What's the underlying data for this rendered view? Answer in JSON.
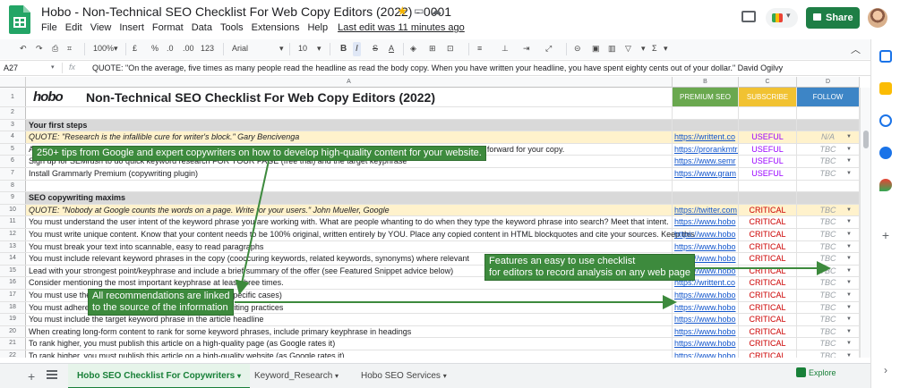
{
  "header": {
    "doc_title": "Hobo - Non-Technical SEO Checklist For Web Copy Editors (2022) - 0001",
    "menus": [
      "File",
      "Edit",
      "View",
      "Insert",
      "Format",
      "Data",
      "Tools",
      "Extensions",
      "Help"
    ],
    "last_edit": "Last edit was 11 minutes ago",
    "share_label": "Share"
  },
  "toolbar": {
    "zoom": "100%",
    "currency": "£",
    "percent": "%",
    "dec_less": ".0",
    "dec_more": ".00",
    "fmt": "123",
    "font": "Arial",
    "size": "10"
  },
  "formula_bar": {
    "cell_ref": "A27",
    "fx": "fx",
    "value": "QUOTE: \"On the average, five times as many people read the headline as read the body copy. When you have written your headline, you have spent eighty cents out of your dollar.\" David Ogilvy"
  },
  "columns": [
    "A",
    "B",
    "C",
    "D"
  ],
  "header_row": {
    "num": "1",
    "title": "Non-Technical SEO Checklist For Web Copy Editors (2022)",
    "logo_text": "hobo",
    "b": "PREMIUM SEO",
    "c": "SUBSCRIBE",
    "d": "FOLLOW"
  },
  "rows": [
    {
      "num": "2",
      "type": "blank",
      "a": "",
      "b": "",
      "c": "",
      "d": ""
    },
    {
      "num": "3",
      "type": "section",
      "a": "Your first steps",
      "b": "",
      "c": "",
      "d": ""
    },
    {
      "num": "4",
      "type": "quote",
      "a": "QUOTE: \"Research is the infallible cure for writer's block.\" Gary Bencivenga",
      "b": "https://writtent.co",
      "c": "USEFUL",
      "d": "N/A"
    },
    {
      "num": "5",
      "type": "item",
      "a": "Add keywords FOR YOUR PAGE to a spreadsheet (free) to track your rankings on a daily level and monitor your progress going forward for your copy.",
      "b": "https://prorankmtra",
      "c": "USEFUL",
      "d": "TBC"
    },
    {
      "num": "6",
      "type": "item",
      "a": "Sign up for SEMrush to do quick keyword research FOR YOUR PAGE (free trial) and the target keyphrase",
      "b": "https://www.semr",
      "c": "USEFUL",
      "d": "TBC"
    },
    {
      "num": "7",
      "type": "item",
      "a": "Install Grammarly Premium (copywriting plugin)",
      "b": "https://www.gram",
      "c": "USEFUL",
      "d": "TBC"
    },
    {
      "num": "8",
      "type": "blank",
      "a": "",
      "b": "",
      "c": "",
      "d": ""
    },
    {
      "num": "9",
      "type": "section",
      "a": "SEO copywriting maxims",
      "b": "",
      "c": "",
      "d": ""
    },
    {
      "num": "10",
      "type": "quote",
      "a": "QUOTE: \"Nobody at Google counts the words on a page. Write for your users.\" John Mueller, Google",
      "b": "https://twitter.com",
      "c": "CRITICAL",
      "d": "TBC"
    },
    {
      "num": "11",
      "type": "item",
      "a": "You must understand the user intent of the keyword phrase you are working with. What are people whanting to do when they type the keyword phrase into search? Meet that intent.",
      "b": "https://www.hobo",
      "c": "CRITICAL",
      "d": "TBC"
    },
    {
      "num": "12",
      "type": "item",
      "a": "You must write unique content. Know that your content needs to be 100% original, written entirely by YOU. Place any copied content in HTML blockquotes and cite your sources. Keep this",
      "b": "https://www.hobo",
      "c": "CRITICAL",
      "d": "TBC"
    },
    {
      "num": "13",
      "type": "item",
      "a": "You must break your text into scannable, easy to read paragraphs",
      "b": "https://www.hobo",
      "c": "CRITICAL",
      "d": "TBC"
    },
    {
      "num": "14",
      "type": "item",
      "a": "You must include relevant keyword phrases in the copy (cooccuring keywords, related keywords, synonyms) where relevant",
      "b": "https://www.hobo",
      "c": "CRITICAL",
      "d": "TBC"
    },
    {
      "num": "15",
      "type": "item",
      "a": "Lead with your strongest point/keyphrase and include a brief summary of the offer (see Featured Snippet advice below)",
      "b": "https://www.hobo",
      "c": "CRITICAL",
      "d": "TBC"
    },
    {
      "num": "16",
      "type": "item",
      "a": "Consider mentioning the most important keyphrase at least three times.",
      "b": "https://writtent.co",
      "c": "CRITICAL",
      "d": "TBC"
    },
    {
      "num": "17",
      "type": "item",
      "a": "You must use the target keyphrase in the title (except in specific cases)",
      "b": "https://www.hobo",
      "c": "CRITICAL",
      "d": "TBC"
    },
    {
      "num": "18",
      "type": "item",
      "a": "You must adhere to Google guidelines and ethical copywriting practices",
      "b": "https://www.hobo",
      "c": "CRITICAL",
      "d": "TBC"
    },
    {
      "num": "19",
      "type": "item",
      "a": "You must include the target keyword phrase in the article headline",
      "b": "https://www.hobo",
      "c": "CRITICAL",
      "d": "TBC"
    },
    {
      "num": "20",
      "type": "item",
      "a": "When creating long-form content to rank for some keyword phrases, include primary keyphrase in headings",
      "b": "https://www.hobo",
      "c": "CRITICAL",
      "d": "TBC"
    },
    {
      "num": "21",
      "type": "item",
      "a": "To rank higher, you must publish this article on a high-quality page (as Google rates it)",
      "b": "https://www.hobo",
      "c": "CRITICAL",
      "d": "TBC"
    },
    {
      "num": "22",
      "type": "item",
      "a": "To rank higher, you must publish this article on a high-quality website (as Google rates it)",
      "b": "https://www.hobo",
      "c": "CRITICAL",
      "d": "TBC"
    }
  ],
  "annotations": {
    "a1": "250+ tips from Google and expert copywriters on how to develop high-quality content for your website.",
    "a2_line1": "Features an easy to use checklist",
    "a2_line2": "for editors to record analysis on any web page",
    "a3_line1": "All recommendations are linked",
    "a3_line2": "to the source of the information"
  },
  "sheet_tabs": [
    "Hobo SEO Checklist For Copywriters",
    "Keyword_Research",
    "Hobo SEO Services"
  ],
  "explore_label": "Explore",
  "colors": {
    "premium": "#6aa84f",
    "subscribe": "#f1c232",
    "follow": "#3d85c6",
    "annotation": "#3d8a3d",
    "share": "#1e7e45"
  }
}
